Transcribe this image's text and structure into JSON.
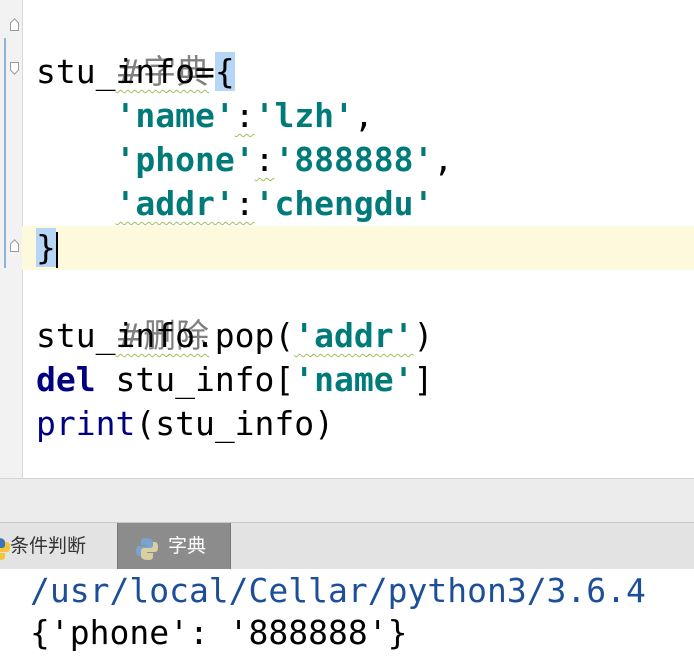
{
  "editor": {
    "comment_dict": "#字典",
    "dict_var": "stu_info",
    "assign": "=",
    "open_brace": "{",
    "indent": "    ",
    "entries": [
      {
        "key": "'name'",
        "colon": ":",
        "value": "'lzh'",
        "sep": ","
      },
      {
        "key": "'phone'",
        "colon": ":",
        "value": "'888888'",
        "sep": ","
      },
      {
        "key": "'addr'",
        "colon": ":",
        "value": "'chengdu'",
        "sep": ""
      }
    ],
    "close_brace": "}",
    "comment_delete": "#删除",
    "pop_call_prefix": "stu_info.pop(",
    "pop_arg": "'addr'",
    "pop_call_suffix": ")",
    "del_keyword": "del",
    "del_target_prefix": " stu_info[",
    "del_arg": "'name'",
    "del_target_suffix": "]",
    "print_fn": "print",
    "print_args": "(stu_info)"
  },
  "run_panel": {
    "tabs": [
      {
        "label": "条件判断",
        "icon": "python-file-icon",
        "active": false
      },
      {
        "label": "字典",
        "icon": "python-file-icon",
        "active": true
      }
    ]
  },
  "console": {
    "lines": [
      "/usr/local/Cellar/python3/3.6.4",
      "{'phone': '888888'}"
    ]
  },
  "colors": {
    "string": "#017a7a",
    "keyword": "#000080",
    "comment": "#808080",
    "current_line": "#fdf9dc",
    "brace_highlight": "#b7d6f5",
    "console_path": "#1d4f99"
  }
}
